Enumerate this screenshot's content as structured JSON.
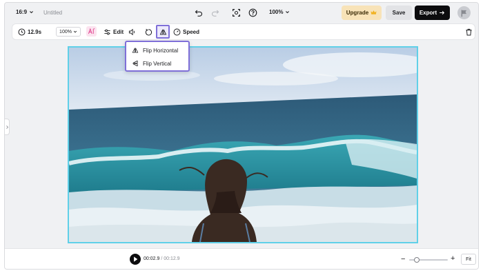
{
  "topbar": {
    "aspect_ratio": "16:9",
    "project_title": "Untitled",
    "zoom": "100%",
    "upgrade_label": "Upgrade",
    "save_label": "Save",
    "export_label": "Export"
  },
  "toolbar": {
    "duration": "12.9s",
    "zoom": "100%",
    "edit_label": "Edit",
    "speed_label": "Speed"
  },
  "flip_menu": {
    "items": [
      {
        "label": "Flip Horizontal",
        "icon": "flip-horizontal-icon"
      },
      {
        "label": "Flip Vertical",
        "icon": "flip-vertical-icon"
      }
    ]
  },
  "player": {
    "current_time": "00:02.9",
    "separator": "/",
    "total_time": "00:12.9",
    "fit_label": "Fit",
    "zoom_level": 0.2
  },
  "colors": {
    "accent": "#7f6fd8",
    "canvas_border": "#5fd0e8",
    "upgrade_bg": "#f8e3b8",
    "export_bg": "#0c0c0e"
  }
}
